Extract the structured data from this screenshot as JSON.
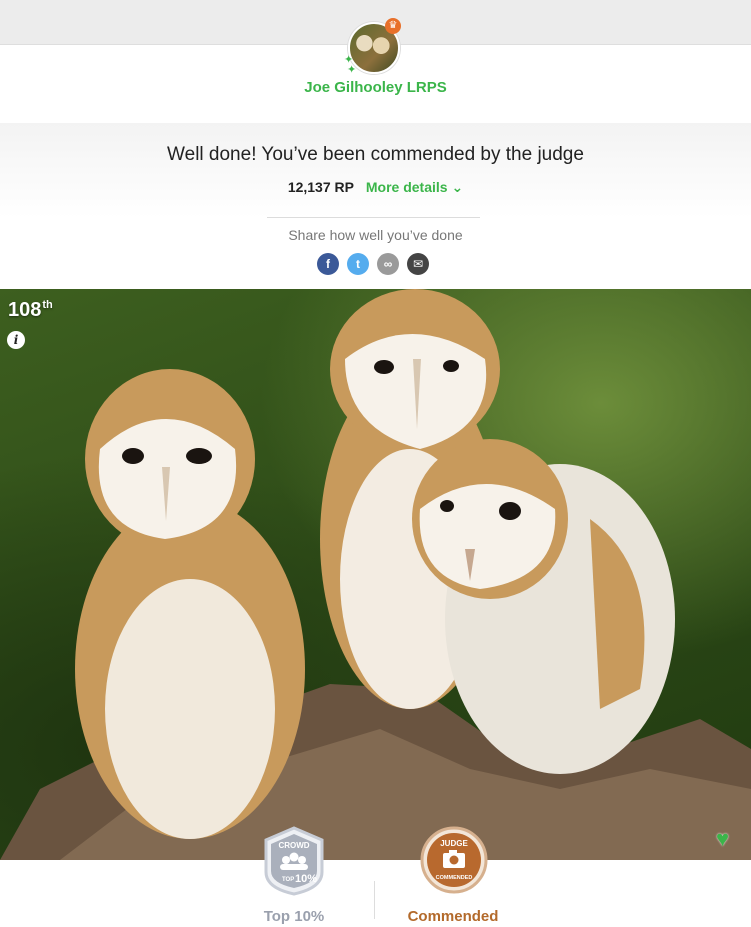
{
  "user": {
    "name": "Joe Gilhooley LRPS",
    "avatar_icon": "owl-avatar-icon",
    "crown_icon": "crown-icon"
  },
  "result": {
    "headline": "Well done! You’ve been commended by the judge",
    "rp": "12,137 RP",
    "more_details": "More details ⌄"
  },
  "share": {
    "text": "Share how well you’ve done",
    "buttons": [
      {
        "name": "facebook",
        "glyph": "f",
        "color": "#3b5998"
      },
      {
        "name": "twitter",
        "glyph": "t",
        "color": "#55acee"
      },
      {
        "name": "copy-link",
        "glyph": "∞",
        "color": "#9a9a9a"
      },
      {
        "name": "email",
        "glyph": "✉",
        "color": "#444444"
      }
    ]
  },
  "photo": {
    "rank_number": "108",
    "rank_suffix": "th",
    "info_glyph": "i",
    "heart_glyph": "♥"
  },
  "awards": [
    {
      "badge_top": "CROWD",
      "badge_bottom": "TOP 10%",
      "small": "TOP",
      "big": "10%",
      "label": "Top 10%",
      "color": "#9aa0ad"
    },
    {
      "badge_top": "JUDGE",
      "badge_bottom": "COMMENDED",
      "label": "Commended",
      "color": "#b36a2b"
    }
  ]
}
